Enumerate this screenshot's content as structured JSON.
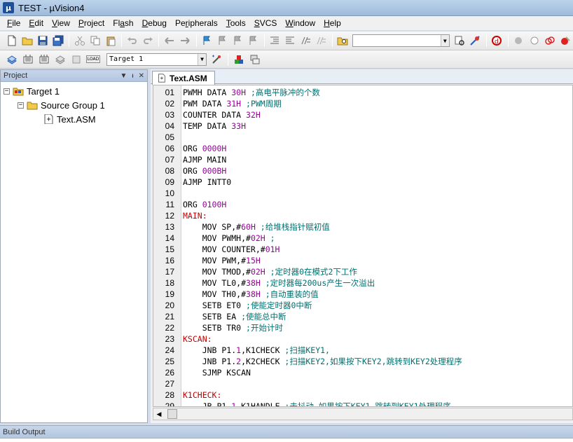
{
  "window": {
    "title": "TEST  -  µVision4",
    "app_icon": "µ"
  },
  "menu": [
    {
      "pre": "",
      "u": "F",
      "post": "ile"
    },
    {
      "pre": "",
      "u": "E",
      "post": "dit"
    },
    {
      "pre": "",
      "u": "V",
      "post": "iew"
    },
    {
      "pre": "",
      "u": "P",
      "post": "roject"
    },
    {
      "pre": "Fl",
      "u": "a",
      "post": "sh"
    },
    {
      "pre": "",
      "u": "D",
      "post": "ebug"
    },
    {
      "pre": "Pe",
      "u": "r",
      "post": "ipherals"
    },
    {
      "pre": "",
      "u": "T",
      "post": "ools"
    },
    {
      "pre": "",
      "u": "S",
      "post": "VCS"
    },
    {
      "pre": "",
      "u": "W",
      "post": "indow"
    },
    {
      "pre": "",
      "u": "H",
      "post": "elp"
    }
  ],
  "toolbar2": {
    "target_combo": "Target 1",
    "load_label": "LOAD"
  },
  "project_panel": {
    "title": "Project",
    "tree": [
      {
        "label": "Target 1",
        "expander": "−",
        "icon": "target-folder-icon"
      },
      {
        "label": "Source Group 1",
        "expander": "−",
        "icon": "folder-icon"
      },
      {
        "label": "Text.ASM",
        "expander": "",
        "icon": "asm-file-icon"
      }
    ]
  },
  "editor": {
    "tab_label": "Text.ASM",
    "lines": [
      {
        "n": "01",
        "parts": [
          [
            "kw",
            "PWMH DATA "
          ],
          [
            "num",
            "30H"
          ],
          [
            "cmt",
            " ;高电平脉冲的个数"
          ]
        ]
      },
      {
        "n": "02",
        "parts": [
          [
            "kw",
            "PWM DATA "
          ],
          [
            "num",
            "31H"
          ],
          [
            "cmt",
            " ;PWM周期"
          ]
        ]
      },
      {
        "n": "03",
        "parts": [
          [
            "kw",
            "COUNTER DATA "
          ],
          [
            "num",
            "32H"
          ]
        ]
      },
      {
        "n": "04",
        "parts": [
          [
            "kw",
            "TEMP DATA "
          ],
          [
            "num",
            "33H"
          ]
        ]
      },
      {
        "n": "05",
        "parts": []
      },
      {
        "n": "06",
        "parts": [
          [
            "kw",
            "ORG "
          ],
          [
            "num",
            "0000H"
          ]
        ]
      },
      {
        "n": "07",
        "parts": [
          [
            "kw",
            "AJMP MAIN"
          ]
        ]
      },
      {
        "n": "08",
        "parts": [
          [
            "kw",
            "ORG "
          ],
          [
            "num",
            "000BH"
          ]
        ]
      },
      {
        "n": "09",
        "parts": [
          [
            "kw",
            "AJMP INTT0"
          ]
        ]
      },
      {
        "n": "10",
        "parts": []
      },
      {
        "n": "11",
        "parts": [
          [
            "kw",
            "ORG "
          ],
          [
            "num",
            "0100H"
          ]
        ]
      },
      {
        "n": "12",
        "parts": [
          [
            "lbl",
            "MAIN:"
          ]
        ]
      },
      {
        "n": "13",
        "parts": [
          [
            "kw",
            "    MOV SP,#"
          ],
          [
            "num",
            "60H"
          ],
          [
            "cmt",
            " ;给堆栈指针赋初值"
          ]
        ]
      },
      {
        "n": "14",
        "parts": [
          [
            "kw",
            "    MOV PWMH,#"
          ],
          [
            "num",
            "02H"
          ],
          [
            "cmt",
            " ;"
          ]
        ]
      },
      {
        "n": "15",
        "parts": [
          [
            "kw",
            "    MOV COUNTER,#"
          ],
          [
            "num",
            "01H"
          ]
        ]
      },
      {
        "n": "16",
        "parts": [
          [
            "kw",
            "    MOV PWM,#"
          ],
          [
            "num",
            "15H"
          ]
        ]
      },
      {
        "n": "17",
        "parts": [
          [
            "kw",
            "    MOV TMOD,#"
          ],
          [
            "num",
            "02H"
          ],
          [
            "cmt",
            " ;定时器0在模式2下工作"
          ]
        ]
      },
      {
        "n": "18",
        "parts": [
          [
            "kw",
            "    MOV TL0,#"
          ],
          [
            "num",
            "38H"
          ],
          [
            "cmt",
            " ;定时器每200us产生一次溢出"
          ]
        ]
      },
      {
        "n": "19",
        "parts": [
          [
            "kw",
            "    MOV TH0,#"
          ],
          [
            "num",
            "38H"
          ],
          [
            "cmt",
            " ;自动重装的值"
          ]
        ]
      },
      {
        "n": "20",
        "parts": [
          [
            "kw",
            "    SETB ET0"
          ],
          [
            "cmt",
            " ;使能定时器0中断"
          ]
        ]
      },
      {
        "n": "21",
        "parts": [
          [
            "kw",
            "    SETB EA"
          ],
          [
            "cmt",
            " ;使能总中断"
          ]
        ]
      },
      {
        "n": "22",
        "parts": [
          [
            "kw",
            "    SETB TR0"
          ],
          [
            "cmt",
            " ;开始计时"
          ]
        ]
      },
      {
        "n": "23",
        "parts": [
          [
            "lbl",
            "KSCAN:"
          ]
        ]
      },
      {
        "n": "24",
        "parts": [
          [
            "kw",
            "    JNB P1."
          ],
          [
            "num",
            "1"
          ],
          [
            "kw",
            ",K1CHECK"
          ],
          [
            "cmt",
            " ;扫描KEY1,"
          ]
        ]
      },
      {
        "n": "25",
        "parts": [
          [
            "kw",
            "    JNB P1."
          ],
          [
            "num",
            "2"
          ],
          [
            "kw",
            ",K2CHECK"
          ],
          [
            "cmt",
            " ;扫描KEY2,如果按下KEY2,跳转到KEY2处理程序"
          ]
        ]
      },
      {
        "n": "26",
        "parts": [
          [
            "kw",
            "    SJMP KSCAN"
          ]
        ]
      },
      {
        "n": "27",
        "parts": []
      },
      {
        "n": "28",
        "parts": [
          [
            "lbl",
            "K1CHECK:"
          ]
        ]
      },
      {
        "n": "29",
        "parts": [
          [
            "kw",
            "    JB P1."
          ],
          [
            "num",
            "1"
          ],
          [
            "kw",
            ",K1HANDLE"
          ],
          [
            "cmt",
            " ;去抖动,如果按下KEY1,跳转到KEY1处理程序"
          ]
        ]
      }
    ]
  },
  "build_output": {
    "title": "Build Output"
  }
}
